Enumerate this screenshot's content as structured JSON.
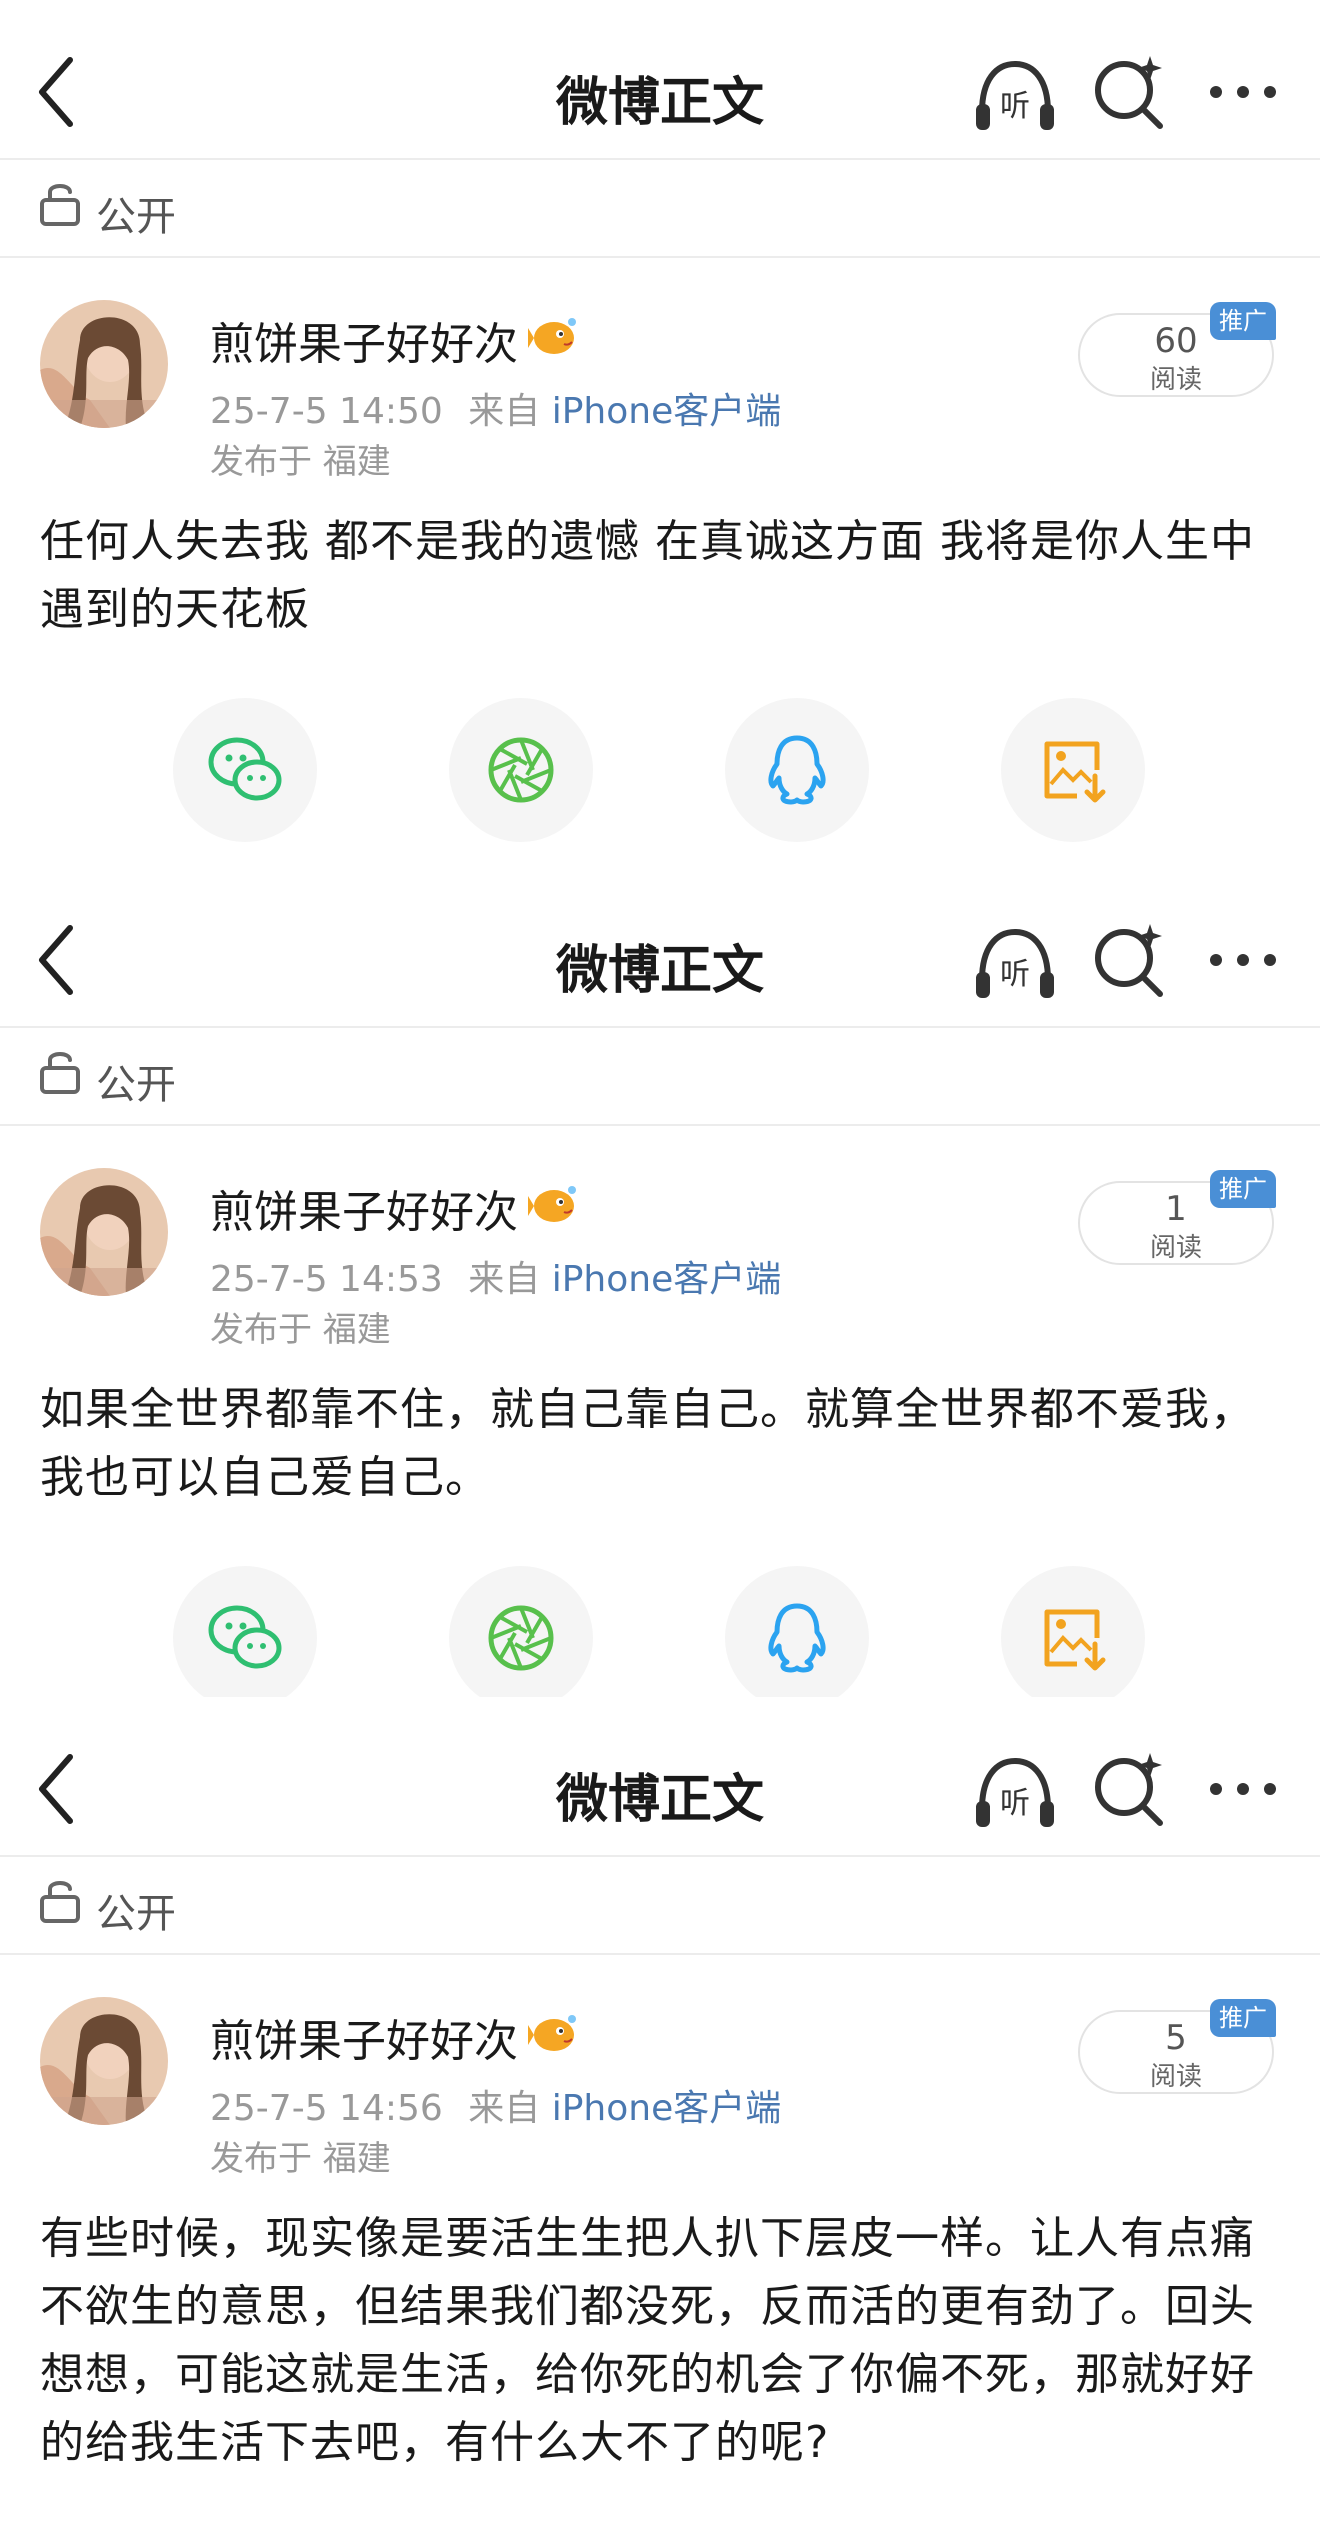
{
  "header": {
    "title": "微博正文",
    "listen_label": "听"
  },
  "visibility": "公开",
  "colors": {
    "accent": "#4a8fd6",
    "source_link": "#4a78b0",
    "wechat": "#2fbf71",
    "moments": "#58c04c",
    "qq": "#2ba3f0",
    "save": "#f2a31f"
  },
  "posts": [
    {
      "username": "煎饼果子好好次",
      "time": "25-7-5 14:50",
      "source_prefix": "来自",
      "source": "iPhone客户端",
      "location": "发布于 福建",
      "read_count": "60",
      "read_label": "阅读",
      "ad_badge": "推广",
      "text": "任何人失去我 都不是我的遗憾 在真诚这方面 我将是你人生中遇到的天花板"
    },
    {
      "username": "煎饼果子好好次",
      "time": "25-7-5 14:53",
      "source_prefix": "来自",
      "source": "iPhone客户端",
      "location": "发布于 福建",
      "read_count": "1",
      "read_label": "阅读",
      "ad_badge": "推广",
      "text": "如果全世界都靠不住，就自己靠自己。就算全世界都不爱我，我也可以自己爱自己。"
    },
    {
      "username": "煎饼果子好好次",
      "time": "25-7-5 14:56",
      "source_prefix": "来自",
      "source": "iPhone客户端",
      "location": "发布于 福建",
      "read_count": "5",
      "read_label": "阅读",
      "ad_badge": "推广",
      "text": "有些时候，现实像是要活生生把人扒下层皮一样。让人有点痛不欲生的意思，但结果我们都没死，反而活的更有劲了。回头想想，可能这就是生活，给你死的机会了你偏不死，那就好好的给我生活下去吧，有什么大不了的呢?"
    }
  ],
  "icons": {
    "back": "chevron-left-icon",
    "listen": "headphones-icon",
    "search": "search-sparkle-icon",
    "more": "more-dots-icon",
    "lock": "unlock-icon",
    "vip": "vip-fish-icon",
    "share": [
      "wechat-icon",
      "moments-icon",
      "qq-icon",
      "save-image-icon"
    ]
  }
}
